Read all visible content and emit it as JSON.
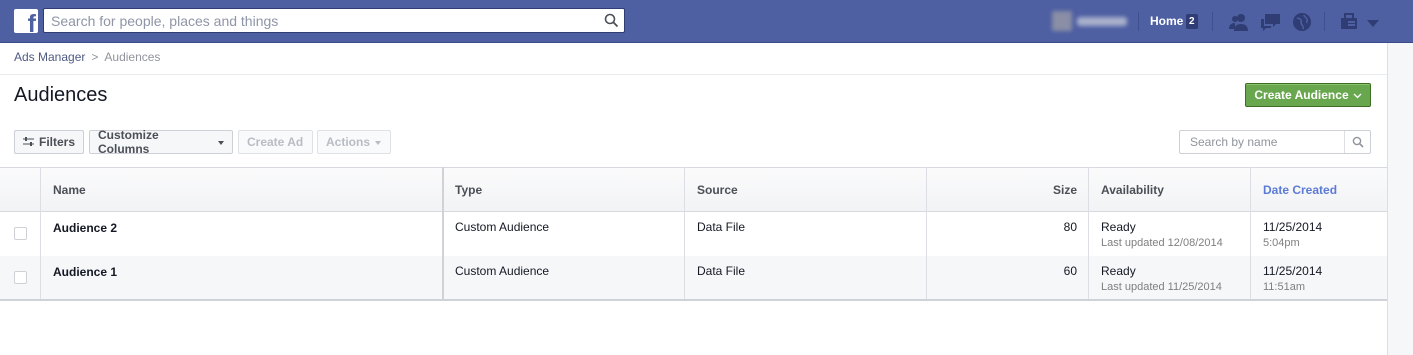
{
  "topbar": {
    "search_placeholder": "Search for people, places and things",
    "logo_letter": "f",
    "home_label": "Home",
    "home_badge": "2"
  },
  "breadcrumb": {
    "root": "Ads Manager",
    "separator": ">",
    "current": "Audiences"
  },
  "page": {
    "title": "Audiences",
    "create_button": "Create Audience"
  },
  "toolbar": {
    "filters": "Filters",
    "customize_columns": "Customize Columns",
    "create_ad": "Create Ad",
    "actions": "Actions",
    "search_placeholder": "Search by name"
  },
  "table": {
    "columns": {
      "name": "Name",
      "type": "Type",
      "source": "Source",
      "size": "Size",
      "availability": "Availability",
      "date_created": "Date Created"
    },
    "rows": [
      {
        "name": "Audience 2",
        "type": "Custom Audience",
        "source": "Data File",
        "size": "80",
        "availability": "Ready",
        "availability_sub": "Last updated 12/08/2014",
        "date": "11/25/2014",
        "time": "5:04pm"
      },
      {
        "name": "Audience 1",
        "type": "Custom Audience",
        "source": "Data File",
        "size": "60",
        "availability": "Ready",
        "availability_sub": "Last updated 11/25/2014",
        "date": "11/25/2014",
        "time": "11:51am"
      }
    ]
  },
  "colors": {
    "topbar": "#4e5fa2",
    "create_button": "#69a74e",
    "sorted_header": "#5b7bd5"
  }
}
